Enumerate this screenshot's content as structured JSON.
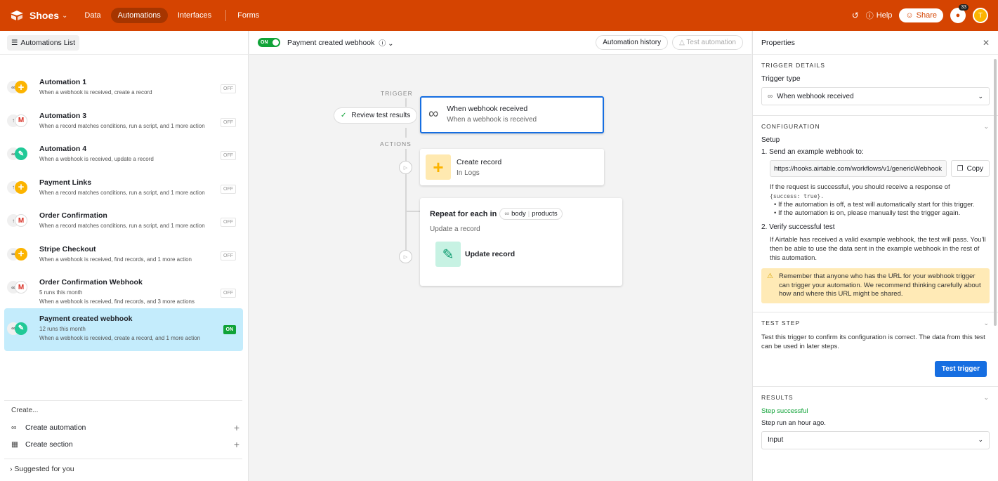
{
  "topbar": {
    "base_name": "Shoes",
    "nav": [
      "Data",
      "Automations",
      "Interfaces",
      "Forms"
    ],
    "help": "Help",
    "share": "Share",
    "notif_count": "33",
    "avatar_initial": "T",
    "accent_color": "#d54401"
  },
  "left": {
    "list_button": "Automations List",
    "automations": [
      {
        "name": "Automation 1",
        "meta": "",
        "desc": "When a webhook is received, create a record",
        "status": "OFF"
      },
      {
        "name": "Automation 3",
        "meta": "",
        "desc": "When a record matches conditions, run a script, and 1 more action",
        "status": "OFF"
      },
      {
        "name": "Automation 4",
        "meta": "",
        "desc": "When a webhook is received, update a record",
        "status": "OFF"
      },
      {
        "name": "Payment Links",
        "meta": "",
        "desc": "When a record matches conditions, run a script, and 1 more action",
        "status": "OFF"
      },
      {
        "name": "Order Confirmation",
        "meta": "",
        "desc": "When a record matches conditions, run a script, and 1 more action",
        "status": "OFF"
      },
      {
        "name": "Stripe Checkout",
        "meta": "",
        "desc": "When a webhook is received, find records, and 1 more action",
        "status": "OFF"
      },
      {
        "name": "Order Confirmation Webhook",
        "meta": "5 runs this month",
        "desc": "When a webhook is received, find records, and 3 more actions",
        "status": "OFF"
      },
      {
        "name": "Payment created webhook",
        "meta": "12 runs this month",
        "desc": "When a webhook is received, create a record, and 1 more action",
        "status": "ON"
      }
    ],
    "create_label": "Create...",
    "create_automation": "Create automation",
    "create_section": "Create section",
    "suggested": "Suggested for you"
  },
  "canvas": {
    "toggle": "ON",
    "title": "Payment created webhook",
    "history_button": "Automation history",
    "test_button": "Test automation",
    "trigger_label": "TRIGGER",
    "actions_label": "ACTIONS",
    "review_button": "Review test results",
    "trigger_card": {
      "title": "When webhook received",
      "sub": "When a webhook is received"
    },
    "create_card": {
      "title": "Create record",
      "sub": "In Logs"
    },
    "repeat_card": {
      "title": "Repeat for each in",
      "chip1": "body",
      "chip2": "products",
      "sub": "Update a record",
      "inner": "Update record"
    }
  },
  "right": {
    "title": "Properties",
    "trigger_details": "TRIGGER DETAILS",
    "trigger_type_label": "Trigger type",
    "trigger_type_value": "When webhook received",
    "configuration": "CONFIGURATION",
    "setup": "Setup",
    "step1": "1. Send an example webhook to:",
    "url": "https://hooks.airtable.com/workflows/v1/genericWebhook",
    "copy": "Copy",
    "success_text": "If the request is successful, you should receive a response of",
    "success_code": "{success: true}.",
    "bullet1": "If the automation is off, a test will automatically start for this trigger.",
    "bullet2": "If the automation is on, please manually test the trigger again.",
    "step2": "2. Verify successful test",
    "verify_text": "If Airtable has received a valid example webhook, the test will pass. You'll then be able to use the data sent in the example webhook in the rest of this automation.",
    "warning": "Remember that anyone who has the URL for your webhook trigger can trigger your automation. We recommend thinking carefully about how and where this URL might be shared.",
    "test_step": "TEST STEP",
    "test_text": "Test this trigger to confirm its configuration is correct. The data from this test can be used in later steps.",
    "test_trigger": "Test trigger",
    "results": "RESULTS",
    "step_success": "Step successful",
    "step_run": "Step run an hour ago.",
    "input": "Input"
  }
}
